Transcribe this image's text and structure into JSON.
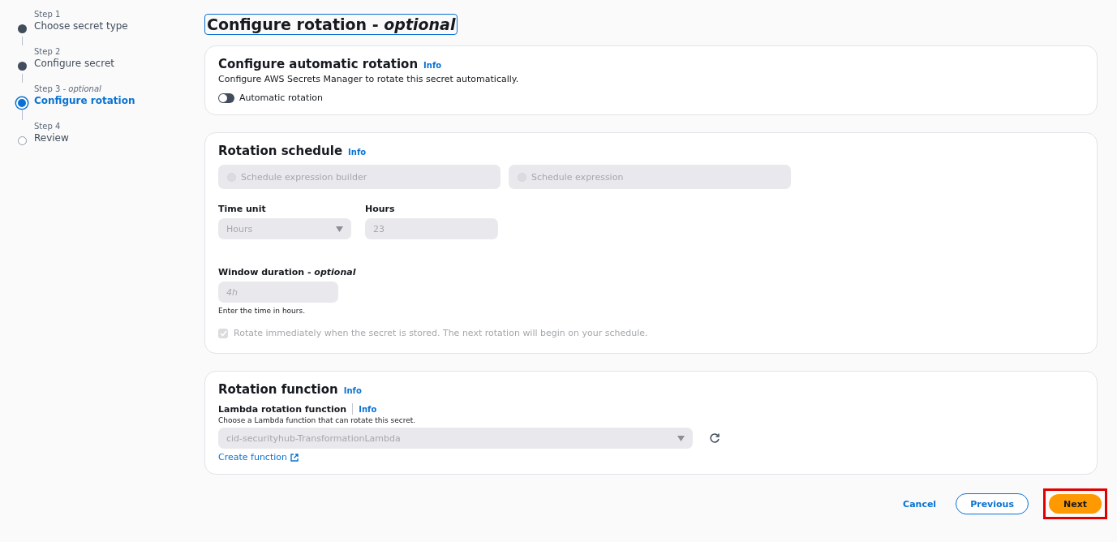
{
  "steps": [
    {
      "step": "Step 1",
      "label": "Choose secret type",
      "completed": true,
      "selected": false
    },
    {
      "step": "Step 2",
      "label": "Configure secret",
      "completed": true,
      "selected": false
    },
    {
      "step": "Step 3 - *optional*",
      "label": "Configure rotation",
      "completed": false,
      "selected": true
    },
    {
      "step": "Step 4",
      "label": "Review",
      "completed": false,
      "selected": false
    }
  ],
  "title": "Configure rotation - *optional*",
  "automatic_rotation": {
    "heading": "Configure automatic rotation",
    "info": "Info",
    "description": "Configure AWS Secrets Manager to rotate this secret automatically.",
    "toggle": {
      "label": "Automatic rotation",
      "on": false
    }
  },
  "rotation_schedule": {
    "heading": "Rotation schedule",
    "info": "Info",
    "options": [
      {
        "label": "Schedule expression builder",
        "selected": false,
        "disabled": true
      },
      {
        "label": "Schedule expression",
        "selected": false,
        "disabled": true
      }
    ],
    "time_unit": {
      "label": "Time unit",
      "value": "Hours",
      "disabled": true
    },
    "hours": {
      "label": "Hours",
      "value": "23",
      "disabled": true
    },
    "window_duration": {
      "label": "Window duration - *optional*",
      "placeholder": "4h",
      "hint": "Enter the time in hours.",
      "disabled": true
    },
    "rotate_immediately": {
      "label": "Rotate immediately when the secret is stored. The next rotation will begin on your schedule.",
      "checked": true,
      "disabled": true
    }
  },
  "rotation_function": {
    "heading": "Rotation function",
    "info": "Info",
    "field_label": "Lambda rotation function",
    "field_info": "Info",
    "description": "Choose a Lambda function that can rotate this secret.",
    "value": "cid-securityhub-TransformationLambda",
    "disabled": true,
    "link": "Create function"
  },
  "footer": {
    "cancel": "Cancel",
    "previous": "Previous",
    "next": {
      "label": "Next",
      "highlighted": true
    }
  }
}
